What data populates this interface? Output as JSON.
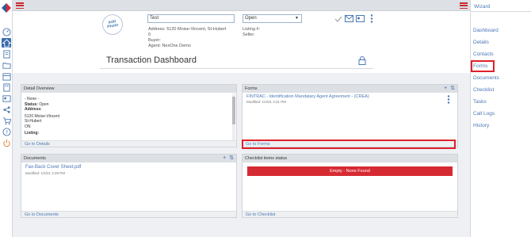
{
  "header": {
    "title_input": "Test",
    "status_select": "Open",
    "address": "Address: 5120 Moise-Vincent, St-Hubert",
    "address_extra": "0",
    "buyer": "Buyer:",
    "agent": "Agent: NexOne Demo",
    "listing": "Listing #:",
    "seller": "Seller:",
    "avatar_text": "Add Photo"
  },
  "dashboard_title": "Transaction Dashboard",
  "detail_overview": {
    "title": "Detail Overview",
    "none_option": "- None -",
    "status_label": "Status:",
    "status_value": "Open",
    "address_label": "Address:",
    "address_line1": "5120 Moise-Vincent",
    "address_line2": "St-Hubert",
    "address_line3": "ON",
    "listing_label": "Listing:",
    "footer": "Go to Details"
  },
  "forms": {
    "title": "Forms",
    "item": "FINTRAC - Identification Mandatary Agent Agreement - (CREA)",
    "modified": "Modified: 1/4/21 2:31 PM",
    "footer": "Go to Forms",
    "add": "+",
    "sort": "⇅"
  },
  "documents": {
    "title": "Documents",
    "item": "Fax-Back Cover Sheet.pdf",
    "modified": "Modified: 1/4/21 2:29 PM",
    "footer": "Go to Documents",
    "add": "+",
    "sort": "⇅"
  },
  "checklist": {
    "title": "Checklist items status",
    "empty": "Empty - None Found",
    "footer": "Go to Checklist"
  },
  "wizard": {
    "title": "Wizard",
    "items": [
      "Dashboard",
      "Details",
      "Contacts",
      "Forms",
      "Documents",
      "Checklist",
      "Tasks",
      "Call Logs",
      "History"
    ]
  },
  "colors": {
    "accent": "#4a78b5",
    "highlight": "#e0202b",
    "danger": "#d62a32"
  }
}
